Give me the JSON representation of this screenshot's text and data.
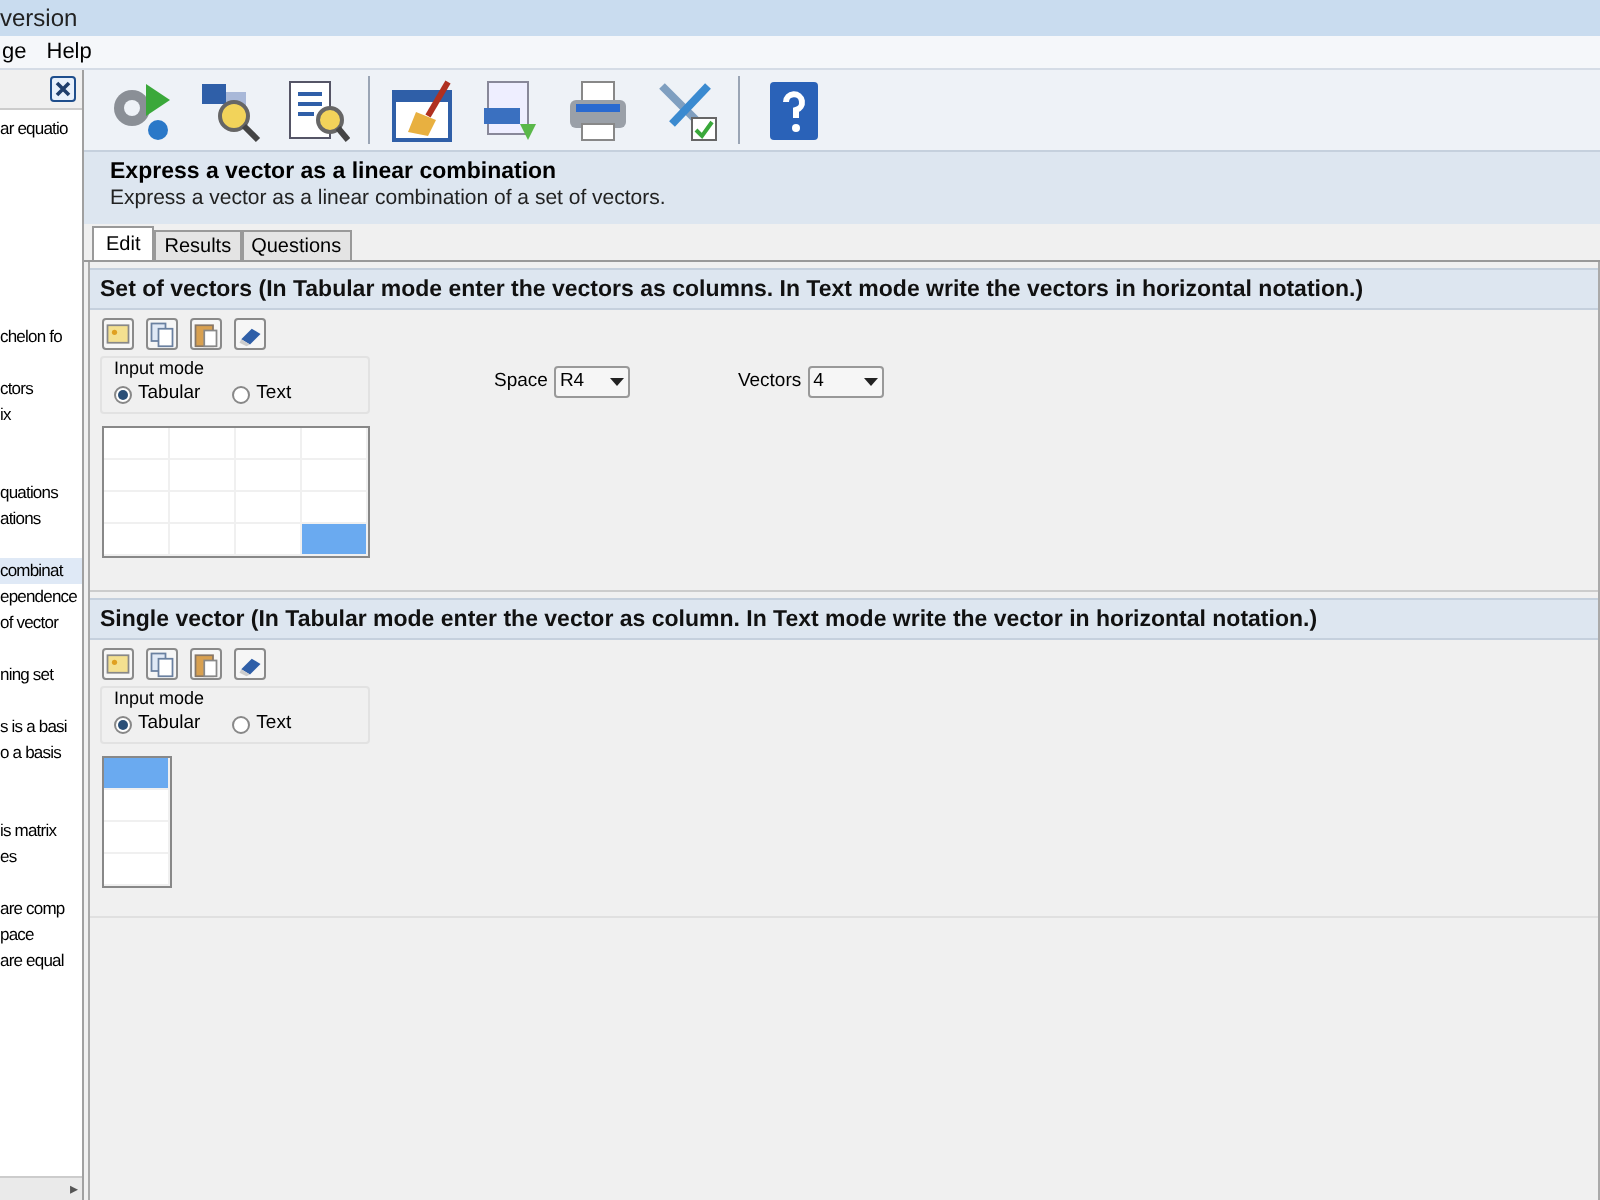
{
  "window": {
    "title": "version"
  },
  "menu": [
    "ge",
    "Help"
  ],
  "sidebar": {
    "items": [
      {
        "label": "ar equatio",
        "selected": false
      },
      {
        "label": "chelon fo",
        "selected": false
      },
      {
        "label": "ctors",
        "selected": false
      },
      {
        "label": "ix",
        "selected": false
      },
      {
        "label": "quations",
        "selected": false
      },
      {
        "label": "ations",
        "selected": false
      },
      {
        "label": "combinat",
        "selected": true
      },
      {
        "label": "ependence",
        "selected": false
      },
      {
        "label": "of vector",
        "selected": false
      },
      {
        "label": "ning set",
        "selected": false
      },
      {
        "label": "s is a basi",
        "selected": false
      },
      {
        "label": "o a basis",
        "selected": false
      },
      {
        "label": "is matrix",
        "selected": false
      },
      {
        "label": "es",
        "selected": false
      },
      {
        "label": "are comp",
        "selected": false
      },
      {
        "label": "pace",
        "selected": false
      },
      {
        "label": "are equal",
        "selected": false
      }
    ],
    "scroll_arrow": "▸"
  },
  "header": {
    "title": "Express a vector as a linear combination",
    "subtitle": "Express a vector as a linear combination of a set of vectors."
  },
  "tabs": [
    {
      "label": "Edit",
      "selected": true
    },
    {
      "label": "Results",
      "selected": false
    },
    {
      "label": "Questions",
      "selected": false
    }
  ],
  "sections": [
    {
      "kind": "set",
      "title": "Set of vectors (In Tabular mode enter the vectors as columns. In Text mode write the vectors in horizontal notation.)",
      "input_mode": {
        "label": "Input mode",
        "options": [
          {
            "label": "Tabular",
            "selected": true
          },
          {
            "label": "Text",
            "selected": false
          }
        ]
      },
      "space": {
        "label": "Space",
        "value": "R4"
      },
      "vectors": {
        "label": "Vectors",
        "value": "4"
      }
    },
    {
      "kind": "single",
      "title": "Single vector (In Tabular mode enter the vector as column. In Text mode write the vector in horizontal notation.)",
      "input_mode": {
        "label": "Input mode",
        "options": [
          {
            "label": "Tabular",
            "selected": true
          },
          {
            "label": "Text",
            "selected": false
          }
        ]
      }
    }
  ]
}
